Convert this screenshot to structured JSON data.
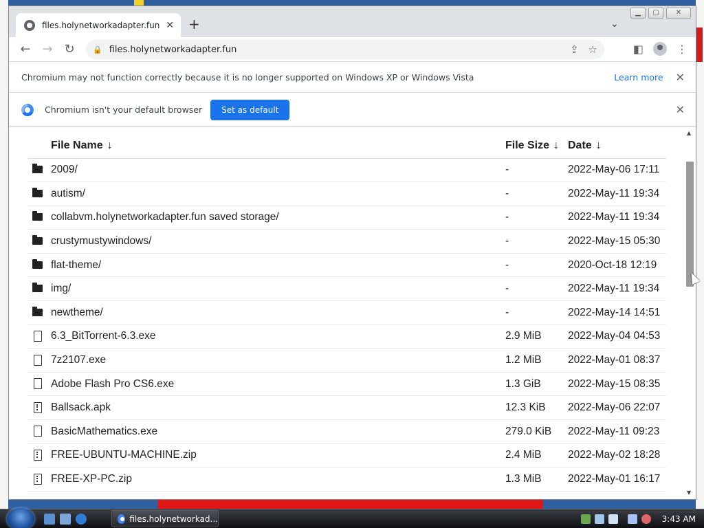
{
  "browser": {
    "tab": {
      "title": "files.holynetworkadapter.fun",
      "close": "✕"
    },
    "new_tab": "+",
    "tab_dropdown": "⌄",
    "window_controls": {
      "minimize": "▁",
      "maximize": "▢",
      "close": "✕"
    },
    "nav": {
      "back": "←",
      "forward": "→",
      "reload": "↻"
    },
    "address": {
      "url": "files.holynetworkadapter.fun"
    }
  },
  "infobars": {
    "unsupported": {
      "text": "Chromium may not function correctly because it is no longer supported on Windows XP or Windows Vista",
      "link": "Learn more",
      "close": "✕"
    },
    "default_browser": {
      "text": "Chromium isn't your default browser",
      "button": "Set as default",
      "close": "✕"
    }
  },
  "listing": {
    "headers": {
      "name": "File Name",
      "size": "File Size",
      "date": "Date",
      "sort_arrow": "↓"
    },
    "rows": [
      {
        "type": "folder",
        "name": "2009/",
        "size": "-",
        "date": "2022-May-06 17:11"
      },
      {
        "type": "folder",
        "name": "autism/",
        "size": "-",
        "date": "2022-May-11 19:34"
      },
      {
        "type": "folder",
        "name": "collabvm.holynetworkadapter.fun saved storage/",
        "size": "-",
        "date": "2022-May-11 19:34"
      },
      {
        "type": "folder",
        "name": "crustymustywindows/",
        "size": "-",
        "date": "2022-May-15 05:30"
      },
      {
        "type": "folder",
        "name": "flat-theme/",
        "size": "-",
        "date": "2020-Oct-18 12:19"
      },
      {
        "type": "folder",
        "name": "img/",
        "size": "-",
        "date": "2022-May-11 19:34"
      },
      {
        "type": "folder",
        "name": "newtheme/",
        "size": "-",
        "date": "2022-May-14 14:51"
      },
      {
        "type": "file",
        "name": "6.3_BitTorrent-6.3.exe",
        "size": "2.9 MiB",
        "date": "2022-May-04 04:53"
      },
      {
        "type": "file",
        "name": "7z2107.exe",
        "size": "1.2 MiB",
        "date": "2022-May-01 08:37"
      },
      {
        "type": "file",
        "name": "Adobe Flash Pro CS6.exe",
        "size": "1.3 GiB",
        "date": "2022-May-15 08:35"
      },
      {
        "type": "archive",
        "name": "Ballsack.apk",
        "size": "12.3 KiB",
        "date": "2022-May-06 22:07"
      },
      {
        "type": "file",
        "name": "BasicMathematics.exe",
        "size": "279.0 KiB",
        "date": "2022-May-11 09:23"
      },
      {
        "type": "archive",
        "name": "FREE-UBUNTU-MACHINE.zip",
        "size": "2.4 MiB",
        "date": "2022-May-02 18:28"
      },
      {
        "type": "archive",
        "name": "FREE-XP-PC.zip",
        "size": "1.3 MiB",
        "date": "2022-May-01 16:17"
      }
    ]
  },
  "taskbar": {
    "active_window": "files.holynetworkad...",
    "clock": "3:43 AM"
  },
  "colors": {
    "accent": "#1a73e8",
    "taskbar": "#1b1e22"
  }
}
